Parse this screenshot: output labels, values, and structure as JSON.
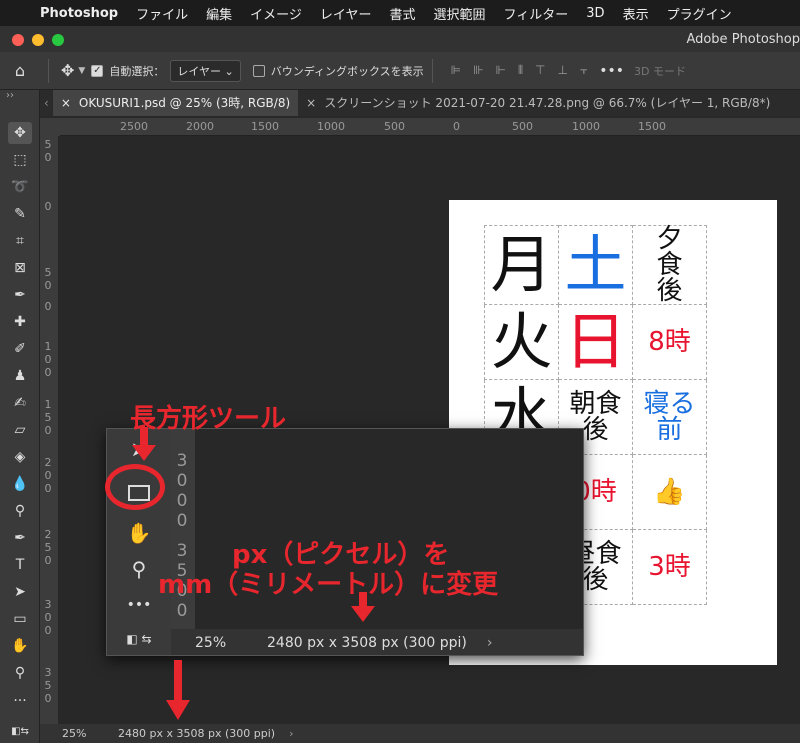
{
  "menubar": {
    "apple_icon": "apple-icon",
    "app_name": "Photoshop",
    "items": [
      "ファイル",
      "編集",
      "イメージ",
      "レイヤー",
      "書式",
      "選択範囲",
      "フィルター",
      "3D",
      "表示",
      "プラグイン"
    ]
  },
  "window": {
    "title": "Adobe Photoshop"
  },
  "options_bar": {
    "auto_select_label": "自動選択：",
    "auto_select_value": "レイヤー",
    "bounding_box_label": "バウンディングボックスを表示",
    "mode_3d_label": "3D モード"
  },
  "tabs": [
    {
      "label": "OKUSURI1.psd @ 25% (3時, RGB/8)",
      "active": true
    },
    {
      "label": "スクリーンショット 2021-07-20 21.47.28.png @ 66.7% (レイヤー 1, RGB/8*)",
      "active": false
    }
  ],
  "rulers": {
    "horizontal": [
      "2500",
      "2000",
      "1500",
      "1000",
      "500",
      "0",
      "500",
      "1000",
      "1500"
    ],
    "vertical": [
      "50",
      "0",
      "50",
      "0",
      "100",
      "150",
      "200",
      "250",
      "300",
      "350"
    ]
  },
  "document": {
    "rows": [
      [
        "月",
        "土",
        "夕食後"
      ],
      [
        "火",
        "日",
        "8時"
      ],
      [
        "水",
        "朝食後",
        "寝る前"
      ],
      [
        "",
        "0時",
        "👍"
      ],
      [
        "",
        "昼食後",
        "3時"
      ]
    ],
    "colors": {
      "blue": "#1a6fe0",
      "red": "#e8132e",
      "black": "#111111"
    }
  },
  "popup": {
    "zoom": "25%",
    "doc_size": "2480 px x 3508 px (300 ppi)",
    "ruler": [
      "3",
      "0",
      "0",
      "0",
      "3",
      "5",
      "0",
      "0"
    ]
  },
  "annotations": {
    "rect_tool_label": "長方形ツール",
    "change_line1": "px（ピクセル）を",
    "change_line2": "mm（ミリメートル）に変更"
  },
  "status_bar": {
    "zoom": "25%",
    "doc_size": "2480 px x 3508 px (300 ppi)"
  }
}
